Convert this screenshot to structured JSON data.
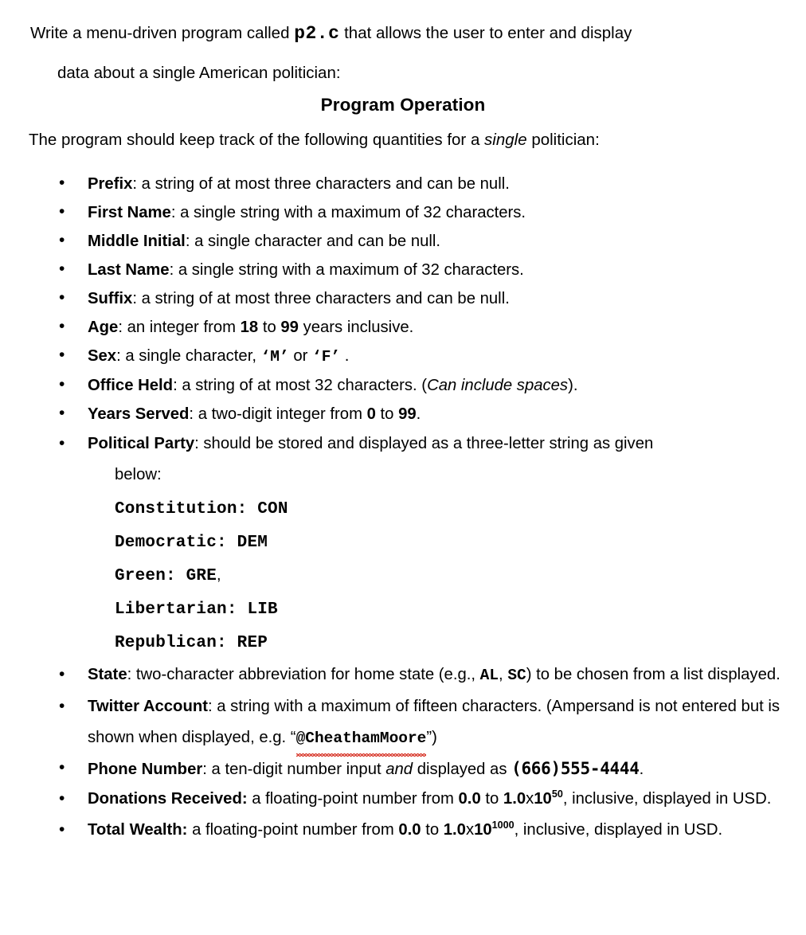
{
  "document": {
    "intro": {
      "line1_before": "Write a menu-driven program called",
      "filename": "p2.c",
      "line1_after": "that allows the user to enter and display",
      "line2": "data about a single American politician:"
    },
    "heading": "Program Operation",
    "leadin": {
      "before": "The program should keep track of the following quantities for a",
      "emphasis": "single",
      "after": "politician:"
    },
    "bullets": [
      {
        "term": "Prefix",
        "sep": ":",
        "text": " a string of at most three characters and can be null."
      },
      {
        "term": "First Name",
        "sep": ":",
        "text": " a single string with a maximum of 32 characters."
      },
      {
        "term": "Middle Initial",
        "sep": ":",
        "text": " a single character and can be null."
      },
      {
        "term": "Last Name",
        "sep": ":",
        "text": " a single string with a maximum of 32 characters."
      },
      {
        "term": "Suffix",
        "sep": ":",
        "text": " a string of at most three characters and can be null."
      },
      {
        "term": "Age",
        "sep": ":",
        "text_a": "  an integer from ",
        "bold_a": "18",
        "text_b": " to ",
        "bold_b": "99",
        "text_c": " years inclusive."
      },
      {
        "term": "Sex",
        "sep": ":",
        "text_a": " a single character, ",
        "code_a": "‘M’",
        "text_b": " or ",
        "code_b": "‘F’",
        "text_c": " ."
      },
      {
        "term": "Office Held",
        "sep": ":",
        "text_a": " a string of at most 32 characters. (",
        "italic": "Can include spaces",
        "text_b": ")."
      },
      {
        "term": "Years Served",
        "sep": ":",
        "text_a": " a two-digit integer from ",
        "bold_a": "0",
        "text_b": " to ",
        "bold_b": "99",
        "text_c": "."
      },
      {
        "term": "Political Party",
        "sep": ":",
        "text": " should be stored and displayed as a three-letter string as given",
        "sub": "below:",
        "parties": [
          {
            "name": "Constitution:",
            "code": "CON",
            "trail": ""
          },
          {
            "name": "Democratic:",
            "code": "DEM",
            "trail": ""
          },
          {
            "name": "Green:",
            "code": "GRE",
            "trail": ","
          },
          {
            "name": "Libertarian:",
            "code": "LIB",
            "trail": ""
          },
          {
            "name": "Republican:",
            "code": "REP",
            "trail": ""
          }
        ]
      },
      {
        "term": "State",
        "sep": ":",
        "text_a": " two-character abbreviation for home state (e.g., ",
        "code_a": "AL",
        "text_b": ", ",
        "code_b": "SC",
        "text_c": ") to be chosen from a list displayed."
      },
      {
        "term": "Twitter Account",
        "sep": ":",
        "text_a": " a string with a maximum of fifteen characters. (Ampersand is not entered but is shown when displayed, e.g.  “",
        "handle": "@CheathamMoore",
        "text_b": "”)"
      },
      {
        "term": "Phone Number",
        "sep": ":",
        "text_a": " a ten-digit number input ",
        "italic": "and",
        "text_b": " displayed as ",
        "phone": "(666)555-4444",
        "text_c": "."
      },
      {
        "term": "Donations Received:",
        "sep": "",
        "text_a": " a floating-point number from ",
        "bold_a": "0.0",
        "text_b": " to ",
        "bold_b": "1.0",
        "x": "x",
        "bold_c": "10",
        "exponent": "50",
        "text_c": ", inclusive, displayed in USD."
      },
      {
        "term": "Total Wealth:",
        "sep": "",
        "text_a": " a floating-point number from ",
        "bold_a": "0.0",
        "text_b": " to ",
        "bold_b": "1.0",
        "x": "x",
        "bold_c": "10",
        "exponent": "1000",
        "text_c": ", inclusive, displayed in USD."
      }
    ]
  },
  "colors": {
    "text": "#000000",
    "background": "#ffffff",
    "spellcheck_underline": "#d52b1e"
  }
}
